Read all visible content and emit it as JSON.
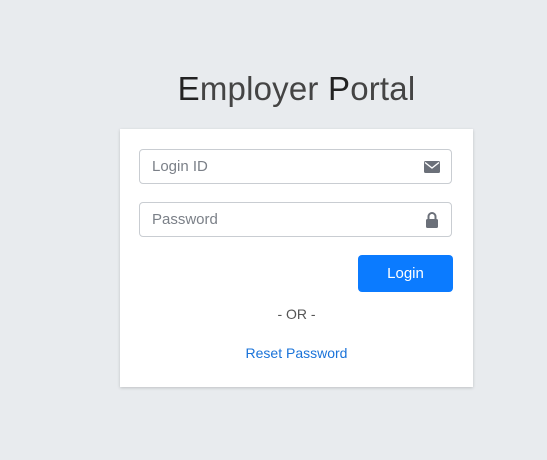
{
  "page": {
    "title_parts": [
      "E",
      "mployer ",
      "P",
      "ortal"
    ]
  },
  "form": {
    "login_id": {
      "placeholder": "Login ID",
      "value": "",
      "icon": "envelope-icon"
    },
    "password": {
      "placeholder": "Password",
      "value": "",
      "icon": "lock-icon"
    },
    "login_button_label": "Login",
    "separator_text": "- OR -",
    "reset_link_label": "Reset Password"
  },
  "colors": {
    "background": "#e8ebee",
    "card": "#ffffff",
    "primary_button": "#0b7bff",
    "link": "#1a73d9"
  }
}
